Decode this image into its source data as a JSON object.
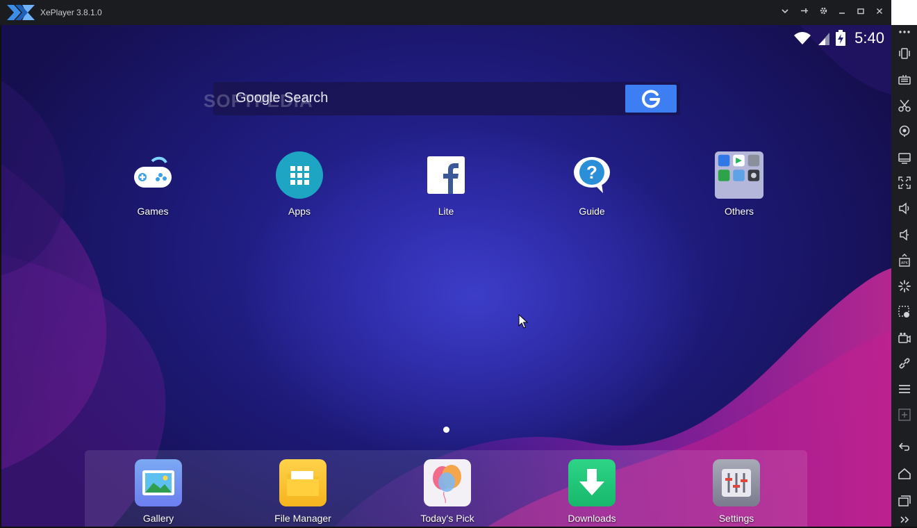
{
  "window": {
    "title": "XePlayer 3.8.1.0",
    "controls": [
      "chevron-down",
      "pin",
      "settings",
      "minimize",
      "maximize",
      "close"
    ]
  },
  "statusbar": {
    "time": "5:40"
  },
  "search": {
    "text": "Google Search",
    "watermark": "SOFTPEDIA"
  },
  "home_apps": [
    {
      "label": "Games",
      "icon": "gamepad-icon"
    },
    {
      "label": "Apps",
      "icon": "apps-grid-icon"
    },
    {
      "label": "Lite",
      "icon": "facebook-lite-icon"
    },
    {
      "label": "Guide",
      "icon": "help-bubble-icon"
    },
    {
      "label": "Others",
      "icon": "folder-icon"
    }
  ],
  "dock_apps": [
    {
      "label": "Gallery",
      "icon": "gallery-icon"
    },
    {
      "label": "File Manager",
      "icon": "file-manager-icon"
    },
    {
      "label": "Today's Pick",
      "icon": "balloons-icon"
    },
    {
      "label": "Downloads",
      "icon": "download-arrow-icon"
    },
    {
      "label": "Settings",
      "icon": "sliders-icon"
    }
  ],
  "toolbar": [
    "more",
    "shake",
    "keyboard",
    "scissors",
    "location",
    "screen",
    "fullscreen",
    "volume-up",
    "volume-down",
    "apk",
    "loading",
    "macro",
    "video-record",
    "link",
    "menu",
    "add",
    "back",
    "home",
    "recents",
    "expand"
  ],
  "colors": {
    "titlebar": "#1b1c1f",
    "google_button": "#3d7ff2",
    "toolbar": "#1d1e22"
  }
}
